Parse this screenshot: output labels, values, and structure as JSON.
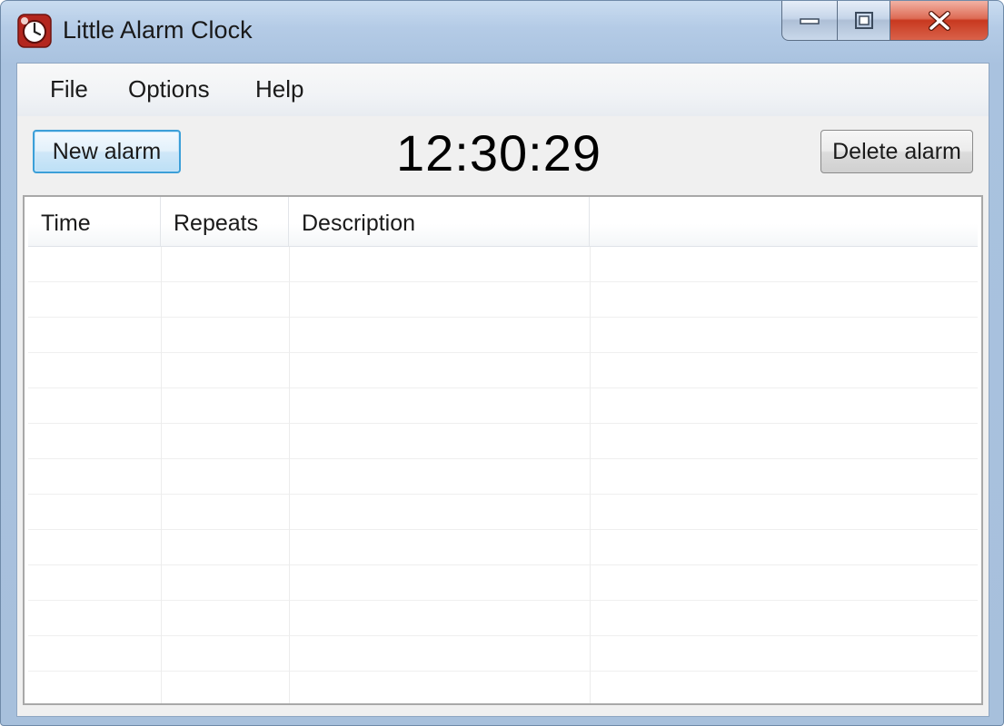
{
  "window": {
    "title": "Little Alarm Clock",
    "icon": "alarm-clock-icon"
  },
  "caption_buttons": [
    "minimize-icon",
    "maximize-icon",
    "close-icon"
  ],
  "menu": {
    "items": [
      {
        "label": "File"
      },
      {
        "label": "Options"
      },
      {
        "label": "Help"
      }
    ]
  },
  "toolbar": {
    "new_alarm_label": "New alarm",
    "delete_alarm_label": "Delete alarm",
    "clock_time": "12:30:29"
  },
  "alarm_list": {
    "columns": [
      {
        "label": "Time"
      },
      {
        "label": "Repeats"
      },
      {
        "label": "Description"
      },
      {
        "label": ""
      }
    ],
    "rows": []
  },
  "colors": {
    "accent_button_border": "#3c9fd8",
    "close_button": "#c8381f",
    "window_frame": "#a9c2df"
  }
}
